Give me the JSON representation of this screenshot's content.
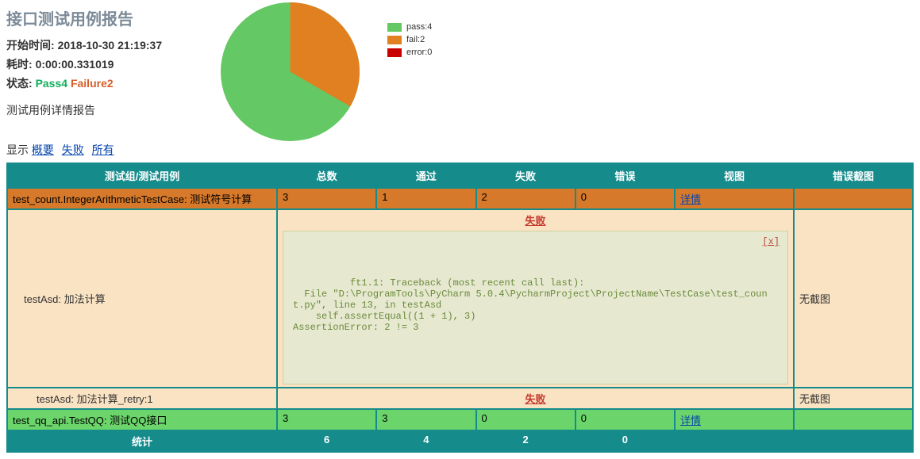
{
  "report": {
    "title": "接口测试用例报告",
    "labels": {
      "start_time": "开始时间:",
      "duration": "耗时:",
      "status": "状态:",
      "detail_heading": "测试用例详情报告",
      "filter_prefix": "显示",
      "filter_overview": "概要",
      "filter_fail": "失败",
      "filter_all": "所有"
    },
    "start_time": "2018-10-30 21:19:37",
    "duration": "0:00:00.331019",
    "status_pass_label": "Pass",
    "status_pass_n": "4",
    "status_fail_label": "Failure",
    "status_fail_n": "2"
  },
  "legend": {
    "pass": "pass:4",
    "fail": "fail:2",
    "error": "error:0"
  },
  "chart_data": {
    "type": "pie",
    "title": "",
    "slices": [
      {
        "name": "pass",
        "value": 4,
        "color": "#64c864"
      },
      {
        "name": "fail",
        "value": 2,
        "color": "#e08020"
      },
      {
        "name": "error",
        "value": 0,
        "color": "#c80000"
      }
    ]
  },
  "columns": {
    "c0": "测试组/测试用例",
    "c1": "总数",
    "c2": "通过",
    "c3": "失败",
    "c4": "错误",
    "c5": "视图",
    "c6": "错误截图"
  },
  "groups": {
    "g1": {
      "name": "test_count.IntegerArithmeticTestCase: 测试符号计算",
      "total": "3",
      "pass": "1",
      "fail": "2",
      "err": "0",
      "detail_link": "详情"
    },
    "g2": {
      "name": "test_qq_api.TestQQ: 测试QQ接口",
      "total": "3",
      "pass": "3",
      "fail": "0",
      "err": "0",
      "detail_link": "详情"
    }
  },
  "cases": {
    "c1": {
      "name": "testAsd: 加法计算",
      "header": "失败",
      "close": "[x]",
      "trace": "ft1.1: Traceback (most recent call last):\n  File \"D:\\ProgramTools\\PyCharm 5.0.4\\PycharmProject\\ProjectName\\TestCase\\test_count.py\", line 13, in testAsd\n    self.assertEqual((1 + 1), 3)\nAssertionError: 2 != 3",
      "screenshot": "无截图"
    },
    "c2": {
      "name": "testAsd: 加法计算_retry:1",
      "header": "失败",
      "screenshot": "无截图"
    }
  },
  "stats": {
    "label": "统计",
    "total": "6",
    "pass": "4",
    "fail": "2",
    "err": "0"
  }
}
